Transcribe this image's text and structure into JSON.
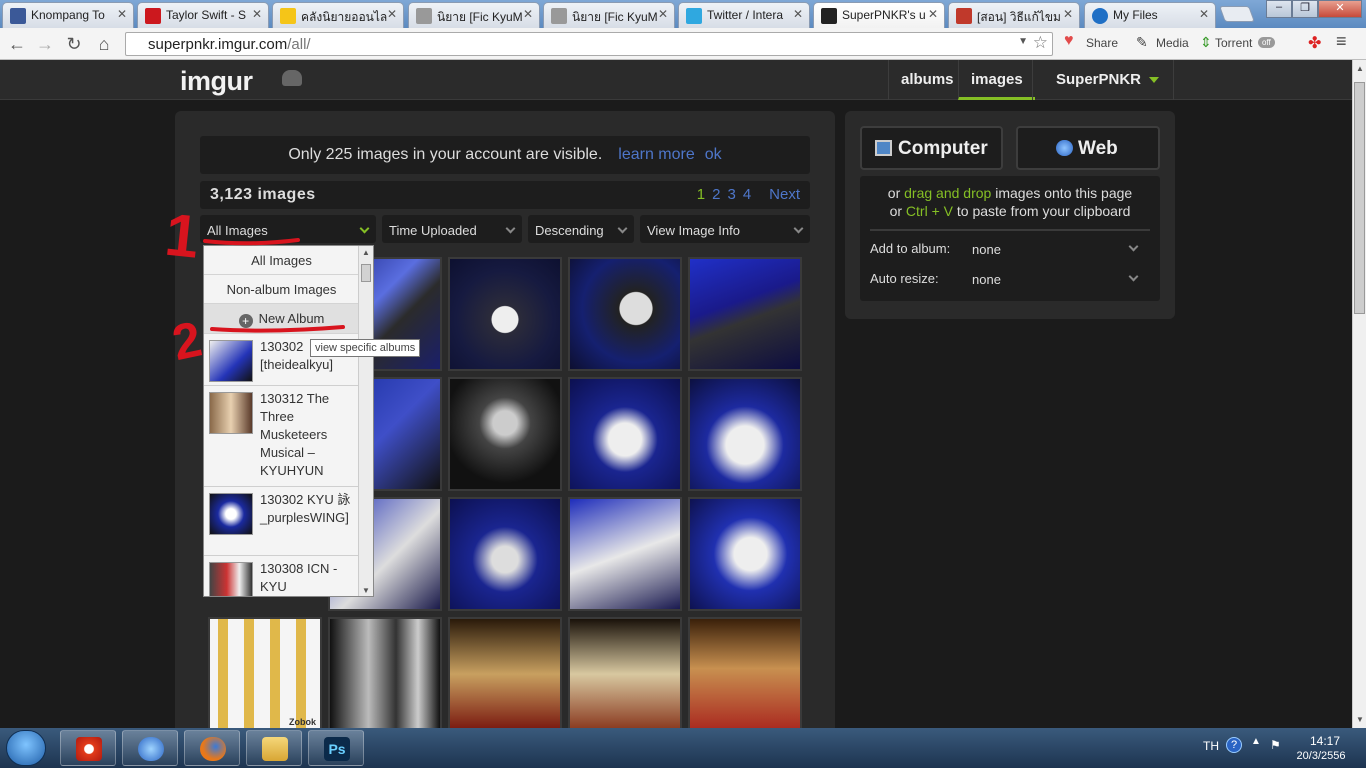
{
  "browser": {
    "tabs": [
      {
        "title": "Knompang To",
        "icon": "facebook-icon",
        "color": "#3b5998"
      },
      {
        "title": "Taylor Swift - S",
        "icon": "youtube-icon",
        "color": "#cc181e"
      },
      {
        "title": "คลังนิยายออนไล",
        "icon": "dek-d-icon",
        "color": "#f5c518"
      },
      {
        "title": "นิยาย [Fic KyuM",
        "icon": "page-icon",
        "color": "#999999"
      },
      {
        "title": "นิยาย [Fic KyuM",
        "icon": "page-icon",
        "color": "#999999"
      },
      {
        "title": "Twitter / Intera",
        "icon": "twitter-icon",
        "color": "#2fa8e0"
      },
      {
        "title": "SuperPNKR's u",
        "icon": "imgur-icon",
        "color": "#222222"
      },
      {
        "title": "[สอน] วิธีแก้ไขม",
        "icon": "page-icon",
        "color": "#c0392b"
      },
      {
        "title": "My Files",
        "icon": "files-icon",
        "color": "#1f6fc5"
      }
    ],
    "url_host": "superpnkr.imgur.com",
    "url_path": "/all/",
    "toolbar": {
      "share": "Share",
      "media": "Media",
      "torrent": "Torrent",
      "torrent_badge": "off"
    }
  },
  "site": {
    "logo": "imgur",
    "nav": {
      "albums": "albums",
      "images": "images",
      "user": "SuperPNKR"
    },
    "notice": {
      "text": "Only 225 images in your account are visible.",
      "learn_more": "learn more",
      "ok": "ok"
    },
    "image_count": "3,123 images",
    "pager": {
      "pages": [
        "1",
        "2",
        "3",
        "4"
      ],
      "next": "Next",
      "current": "1"
    },
    "filters": {
      "album": "All Images",
      "sort_by": "Time Uploaded",
      "order": "Descending",
      "view": "View Image Info"
    },
    "menu": {
      "all_images": "All Images",
      "non_album": "Non-album Images",
      "new_album": "New Album",
      "tooltip": "view specific albums",
      "albums": [
        "130302 [theidealkyu]",
        "130312 The Three Musketeers Musical – KYUHYUN",
        "130302 KYU 詠 _purplesWING]",
        "130308 ICN - KYU"
      ]
    },
    "thumbnail_watermark": "Zobok",
    "upload": {
      "computer": "Computer",
      "web": "Web",
      "line1_prefix": "or ",
      "drag_drop": "drag and drop",
      "line1_suffix": " images onto this page",
      "line2_prefix": "or ",
      "ctrl_v": "Ctrl + V",
      "line2_suffix": " to paste from your clipboard",
      "add_to_album_label": "Add to album:",
      "add_to_album_value": "none",
      "auto_resize_label": "Auto resize:",
      "auto_resize_value": "none"
    },
    "annotations": {
      "step1": "1",
      "step2": "2"
    }
  },
  "taskbar": {
    "lang": "TH",
    "time": "14:17",
    "date": "20/3/2556"
  },
  "colors": {
    "accent_green": "#85bf25",
    "link_blue": "#4e76c9",
    "annotation_red": "#d8141e"
  }
}
